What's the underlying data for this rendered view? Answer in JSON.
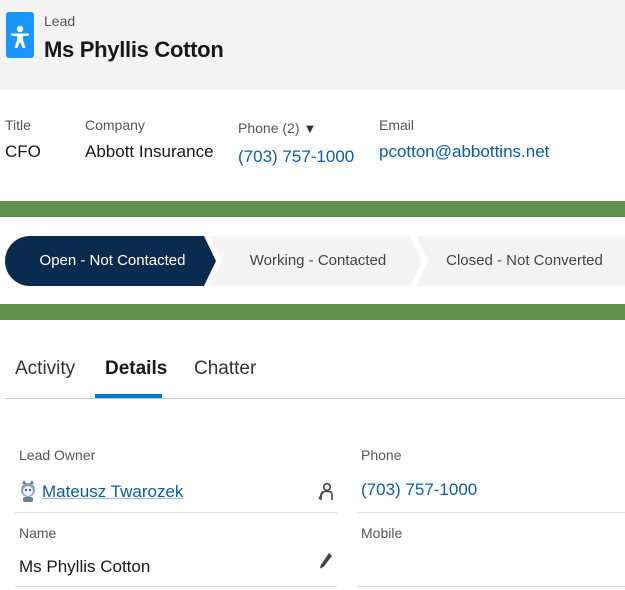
{
  "header": {
    "object_type": "Lead",
    "record_name": "Ms Phyllis Cotton",
    "icon": "lead-person-icon",
    "icon_color": "#1b96ff"
  },
  "highlights": {
    "title_label": "Title",
    "title_value": "CFO",
    "company_label": "Company",
    "company_value": "Abbott Insurance",
    "phone_label": "Phone (2)",
    "phone_value": "(703) 757-1000",
    "email_label": "Email",
    "email_value": "pcotton@abbottins.net"
  },
  "path": {
    "stages": [
      {
        "label": "Open - Not Contacted",
        "active": true
      },
      {
        "label": "Working - Contacted",
        "active": false
      },
      {
        "label": "Closed - Not Converted",
        "active": false
      }
    ],
    "active_color": "#0b2b4e",
    "inactive_color": "#f3f3f3"
  },
  "accent_bar_color": "#5b8f4b",
  "tabs": [
    {
      "label": "Activity",
      "active": false
    },
    {
      "label": "Details",
      "active": true
    },
    {
      "label": "Chatter",
      "active": false
    }
  ],
  "details": {
    "lead_owner_label": "Lead Owner",
    "lead_owner_value": "Mateusz Twarozek",
    "phone_label": "Phone",
    "phone_value": "(703) 757-1000",
    "name_label": "Name",
    "name_value": "Ms Phyllis Cotton",
    "mobile_label": "Mobile",
    "mobile_value": ""
  }
}
